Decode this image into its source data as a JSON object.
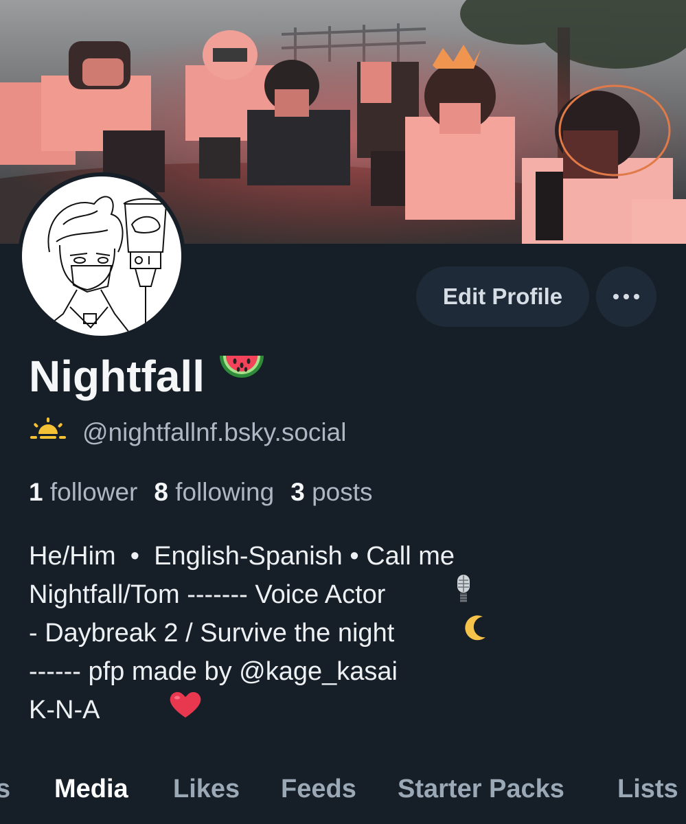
{
  "profile": {
    "display_name": "Nightfall",
    "display_name_emoji": "watermelon-emoji",
    "handle": "@nightfallnf.bsky.social",
    "handle_icon": "sunrise-icon",
    "edit_profile_label": "Edit Profile",
    "more_label": "•••"
  },
  "stats": {
    "followers_count": "1",
    "followers_label": "follower",
    "following_count": "8",
    "following_label": "following",
    "posts_count": "3",
    "posts_label": "posts"
  },
  "bio": {
    "lines": [
      "He/Him  •  English-Spanish • Call me",
      "Nightfall/Tom ------- Voice Actor",
      "- Daybreak 2 / Survive the night",
      "------ pfp made by @kage_kasai",
      "K-N-A"
    ],
    "line_icons": [
      "",
      "microphone-emoji",
      "crescent-moon-emoji",
      "",
      "red-heart-emoji"
    ]
  },
  "tabs": [
    {
      "label": "s",
      "active": false
    },
    {
      "label": "Media",
      "active": true
    },
    {
      "label": "Likes",
      "active": false
    },
    {
      "label": "Feeds",
      "active": false
    },
    {
      "label": "Starter Packs",
      "active": false
    },
    {
      "label": "Lists",
      "active": false
    }
  ],
  "colors": {
    "background": "#161e27",
    "button_bg": "#1e2a37",
    "muted_text": "#aeb8c4",
    "primary_text": "#f4f6f8",
    "tab_inactive": "#9ba8b6"
  }
}
